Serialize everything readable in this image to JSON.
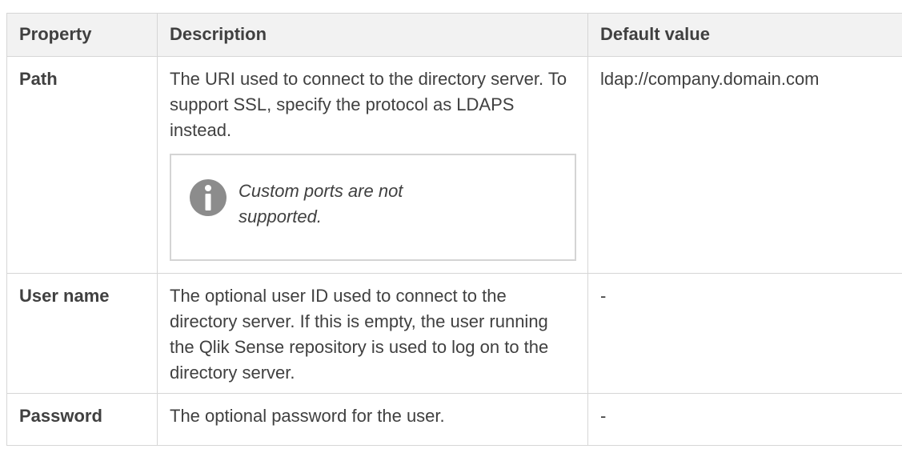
{
  "table": {
    "headers": [
      "Property",
      "Description",
      "Default value"
    ],
    "rows": [
      {
        "property": "Path",
        "description": "The URI used to connect to the directory server. To support SSL, specify the protocol as LDAPS instead.",
        "note": "Custom ports are not supported.",
        "default": "ldap://company.domain.com"
      },
      {
        "property": "User name",
        "description": "The optional user ID used to connect to the directory server. If this is empty, the user running the Qlik Sense repository is used to log on to the directory server.",
        "default": "-"
      },
      {
        "property": "Password",
        "description": "The optional password for the user.",
        "default": "-"
      }
    ]
  },
  "note_icon": "info-icon",
  "colors": {
    "text": "#404040",
    "header_bg": "#f2f2f2",
    "border": "#d6d6d6",
    "icon": "#8c8c8c"
  }
}
